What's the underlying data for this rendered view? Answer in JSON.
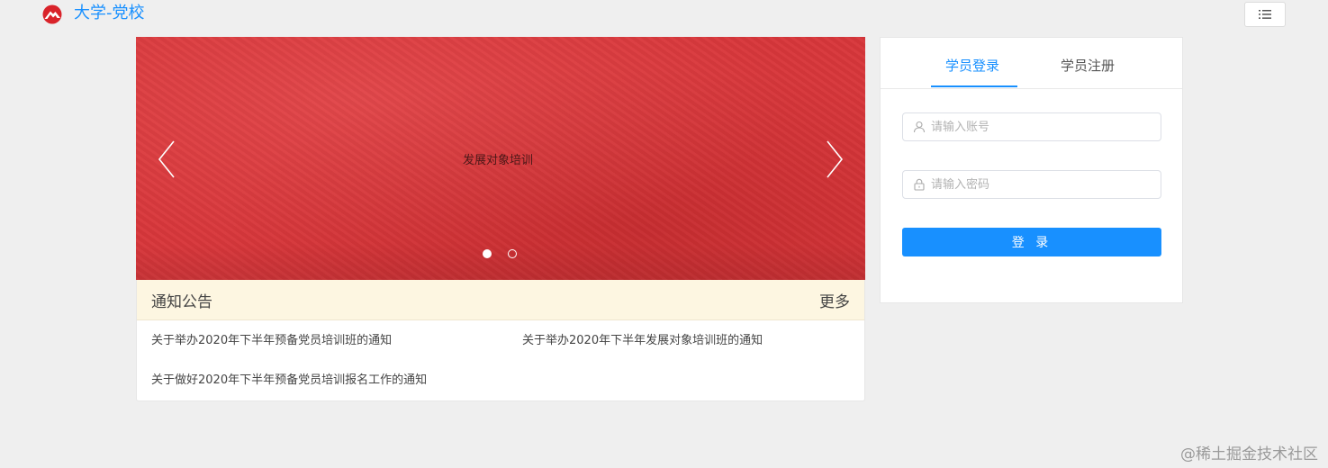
{
  "header": {
    "site_title": "大学-党校",
    "logo_icon": "mountain-logo-icon",
    "menu_icon": "list-menu-icon"
  },
  "carousel": {
    "caption": "发展对象培训",
    "slide_count": 2,
    "active_slide": 1,
    "background_color": "#d8373b"
  },
  "notice": {
    "title": "通知公告",
    "more": "更多",
    "items": [
      "关于举办2020年下半年预备党员培训班的通知",
      "关于举办2020年下半年发展对象培训班的通知",
      "关于做好2020年下半年预备党员培训报名工作的通知"
    ]
  },
  "login": {
    "tabs": [
      "学员登录",
      "学员注册"
    ],
    "active_tab": 0,
    "username_placeholder": "请输入账号",
    "password_placeholder": "请输入密码",
    "button": "登 录",
    "accent_color": "#1890ff"
  },
  "watermark": "@稀土掘金技术社区"
}
